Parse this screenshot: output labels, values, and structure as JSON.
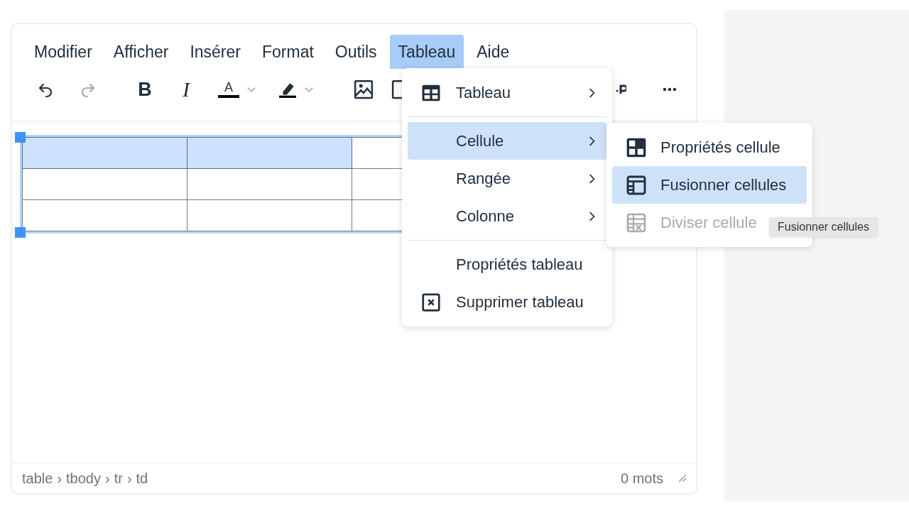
{
  "menubar": [
    {
      "label": "Modifier",
      "selected": false
    },
    {
      "label": "Afficher",
      "selected": false
    },
    {
      "label": "Insérer",
      "selected": false
    },
    {
      "label": "Format",
      "selected": false
    },
    {
      "label": "Outils",
      "selected": false
    },
    {
      "label": "Tableau",
      "selected": true
    },
    {
      "label": "Aide",
      "selected": false
    }
  ],
  "toolbar": [
    {
      "kind": "undo",
      "disabled": false
    },
    {
      "kind": "redo",
      "disabled": true
    },
    {
      "kind": "bold",
      "glyph": "B",
      "disabled": false
    },
    {
      "kind": "italic",
      "glyph": "I",
      "disabled": false
    },
    {
      "kind": "text-color",
      "glyph": "A",
      "disabled": false
    },
    {
      "kind": "caret",
      "disabled": false
    },
    {
      "kind": "highlight",
      "disabled": false
    },
    {
      "kind": "caret",
      "disabled": false
    },
    {
      "kind": "image",
      "disabled": false
    },
    {
      "kind": "frame",
      "disabled": false
    },
    {
      "kind": "partial",
      "disabled": false
    },
    {
      "kind": "more",
      "disabled": false
    }
  ],
  "table": {
    "rows": [
      {
        "cells": [
          {
            "selected": true
          },
          {
            "selected": true
          },
          {
            "selected": false
          }
        ]
      },
      {
        "cells": [
          {
            "selected": false
          },
          {
            "selected": false
          },
          {
            "selected": false
          }
        ]
      },
      {
        "cells": [
          {
            "selected": false
          },
          {
            "selected": false
          },
          {
            "selected": false
          }
        ]
      }
    ]
  },
  "menu": {
    "items": [
      {
        "kind": "table",
        "label": "Tableau",
        "selected": false,
        "disabled": false
      },
      {
        "kind": "divider"
      },
      {
        "kind": "submenu",
        "label": "Cellule",
        "selected": true,
        "disabled": false
      },
      {
        "kind": "submenu",
        "label": "Rangée",
        "selected": false,
        "disabled": false
      },
      {
        "kind": "submenu",
        "label": "Colonne",
        "selected": false,
        "disabled": false
      },
      {
        "kind": "divider"
      },
      {
        "kind": "plain",
        "label": "Propriétés tableau",
        "selected": false,
        "disabled": false
      },
      {
        "kind": "delete",
        "label": "Supprimer tableau",
        "selected": false,
        "disabled": false
      }
    ]
  },
  "submenu": {
    "items": [
      {
        "kind": "cell-properties",
        "label": "Propriétés cellule",
        "selected": false,
        "disabled": false
      },
      {
        "kind": "merge",
        "label": "Fusionner cellules",
        "selected": true,
        "disabled": false
      },
      {
        "kind": "split",
        "label": "Diviser cellule",
        "selected": false,
        "disabled": true
      }
    ]
  },
  "tooltip": {
    "text": "Fusionner cellules"
  },
  "status_bar": {
    "path": [
      {
        "label": "table",
        "separator": "›"
      },
      {
        "label": "tbody",
        "separator": "›"
      },
      {
        "label": "tr",
        "separator": "›"
      },
      {
        "label": "td"
      }
    ],
    "word_count": "0 mots"
  }
}
